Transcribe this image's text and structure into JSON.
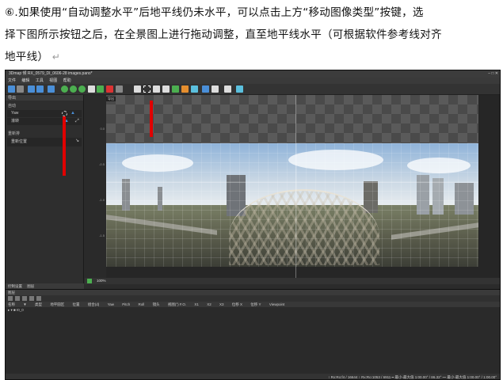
{
  "document": {
    "line1": "⑥.如果使用“自动调整水平”后地平线仍未水平，可以点击上方“移动图像类型”按键，选",
    "line2": "择下图所示按钮之后，在全景图上进行拖动调整，直至地平线水平（可根据软件参考线对齐",
    "line3": "地平线）",
    "return_mark": "↵"
  },
  "app": {
    "title": "3Dmap 倾 RX_0579_DI_0606-28 images.pano*",
    "window_controls": "– □ ✕",
    "menu": [
      "文件",
      "编辑",
      "工具",
      "视图",
      "帮助"
    ],
    "left_panel": {
      "title": "导出",
      "section1": "自动",
      "row1_label": "Yaw",
      "row2_label": "滚转",
      "section2": "重新排",
      "row3_label": "重新位置"
    },
    "panel_tabs": [
      "控制设置",
      "图层"
    ],
    "viewport_label": "导出",
    "ruler_marks": [
      "0.0",
      "-0.5",
      "-1.0",
      "-1.5"
    ],
    "zoom_value": "100%",
    "bottom": {
      "title": "图层",
      "columns": [
        "名称",
        "▼",
        "类型",
        "地平圆区",
        "位置",
        "组合(d)",
        "Yaw",
        "Pitch",
        "Roll",
        "镜头",
        "视图(°) F.O.",
        "X1",
        "X2",
        "X3",
        "位移 X",
        "位移 Y",
        "Viewpoint"
      ],
      "tree_item": "▸ ▾ ■ I0_0"
    },
    "status": "↑ Rx:Ro:f4 / 16644   ↑ Rx:Ro:1053 / 6911   ━ 最小-最大值 1:00.00° / 86.32°   ━ 最小-最大值 1:00.00° / 1:00.00°"
  },
  "colors": {
    "annotation_arrow": "#e00000",
    "app_background": "#2b2b2b"
  }
}
